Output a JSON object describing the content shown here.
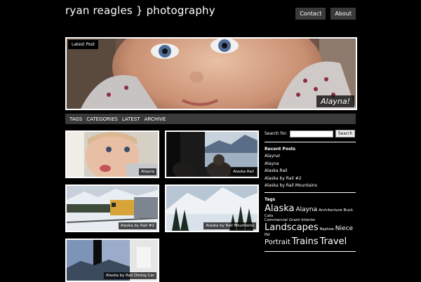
{
  "header": {
    "title": "ryan reagles } photography",
    "nav": [
      {
        "label": "Contact"
      },
      {
        "label": "About"
      }
    ]
  },
  "hero": {
    "badge": "Latest Post",
    "caption": "Alayna!"
  },
  "catbar": {
    "links": [
      "TAGS",
      "CATEGORIES",
      "LATEST",
      "ARCHIVE"
    ]
  },
  "posts": [
    {
      "label": "Alayna"
    },
    {
      "label": "Alaska Rail"
    },
    {
      "label": "Alaska by Rail #2"
    },
    {
      "label": "Alaska by Rail Mountains"
    },
    {
      "label": "Alaska by Rail Dining Car"
    }
  ],
  "sidebar": {
    "search_label": "Search for:",
    "search_button": "Search",
    "recent_heading": "Recent Posts",
    "recent": [
      "Alayna!",
      "Alayna",
      "Alaska Rail",
      "Alaska by Rail #2",
      "Alaska by Rail Mountains"
    ],
    "tags_heading": "Tags",
    "tags": [
      {
        "text": "Alaska",
        "size": "lg"
      },
      {
        "text": "Alayna",
        "size": "md"
      },
      {
        "text": "Architecture",
        "size": "sm"
      },
      {
        "text": "Buck",
        "size": "sm"
      },
      {
        "text": "Cats",
        "size": "sm"
      },
      {
        "text": "Commercial",
        "size": "sm"
      },
      {
        "text": "Grant",
        "size": "sm"
      },
      {
        "text": "Interior",
        "size": "sm"
      },
      {
        "text": "Landscapes",
        "size": "xl"
      },
      {
        "text": "Nephew",
        "size": "sm"
      },
      {
        "text": "Niece",
        "size": "md"
      },
      {
        "text": "Pet",
        "size": "sm"
      },
      {
        "text": "Portrait",
        "size": "md2"
      },
      {
        "text": "Trains",
        "size": "xl"
      },
      {
        "text": "Travel",
        "size": "xl"
      }
    ]
  }
}
